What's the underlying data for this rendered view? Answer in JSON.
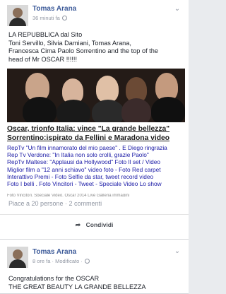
{
  "post1": {
    "author": "Tomas Arana",
    "time": "36 minuti fa",
    "text_lines": [
      "LA REPUBBLICA dal Sito",
      "Toni Servillo, Silvia Damiani, Tomas Arana,",
      "Francesca Cima Paolo Sorrentino and the top of the",
      "head of Mr OSCAR !!!!!!"
    ],
    "headline_lines": [
      "Oscar, trionfo Italia: vince \"La grande bellezza\"",
      "Sorrentino:ispirato da Fellini e Maradona video"
    ],
    "link_lines": [
      "RepTv \"Un film innamorato del mio paese\" . E Diego ringrazia",
      "Rep Tv Verdone: \"In Italia non solo crolli, grazie Paolo\"",
      "RepTv Maltese: \"Applausi da Hollywood\" Foto Il set / Video",
      "Miglior film a \"12 anni schiavo\" video foto - Foto Red carpet",
      "Interattivo Premi - Foto Selfie da star, tweet record video",
      "Foto I belli . Foto Vincitori - Tweet - Speciale Video Lo show"
    ],
    "footer_cut_text": "Foto Vincitori, Speciale Video, Oscar 2014 Live Galleria immagini",
    "likes_line": "Piace a 20 persone · 2 commenti",
    "share_label": "Condividi"
  },
  "post2": {
    "author": "Tomas Arana",
    "time": "8 ore fa · Modificato ·",
    "text_lines": [
      "Congratulations for the OSCAR",
      "THE GREAT BEAUTY LA GRANDE BELLEZZA"
    ]
  }
}
